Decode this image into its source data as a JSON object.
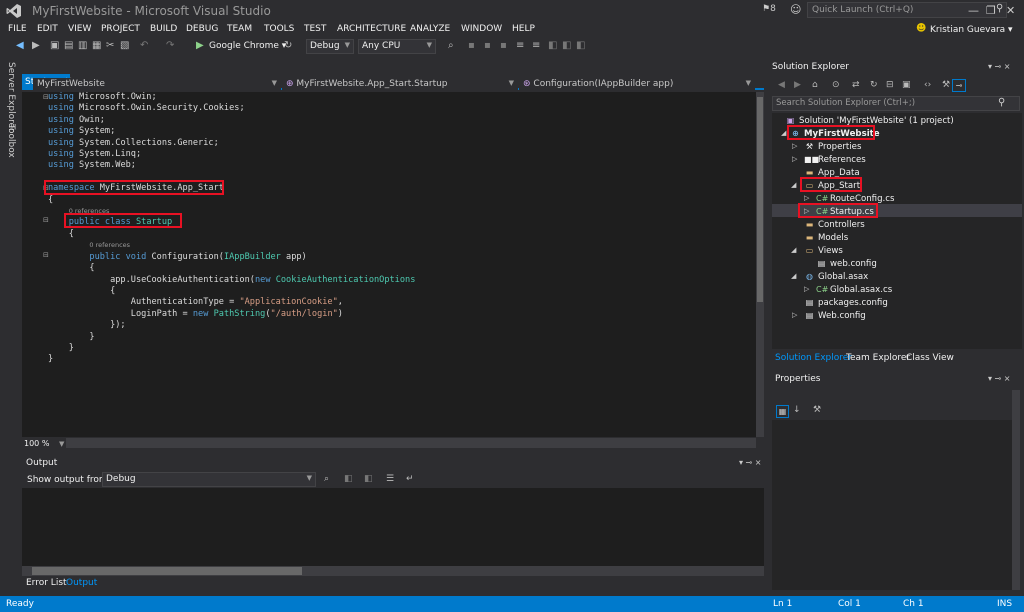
{
  "window": {
    "title": "MyFirstWebsite - Microsoft Visual Studio",
    "notification_count": "8",
    "quick_launch_placeholder": "Quick Launch (Ctrl+Q)",
    "user": "Kristian Guevara"
  },
  "menu": [
    "FILE",
    "EDIT",
    "VIEW",
    "PROJECT",
    "BUILD",
    "DEBUG",
    "TEAM",
    "TOOLS",
    "TEST",
    "ARCHITECTURE",
    "ANALYZE",
    "WINDOW",
    "HELP"
  ],
  "toolbar": {
    "browser_label": "Google Chrome",
    "config": "Debug",
    "platform": "Any CPU"
  },
  "side_tabs": {
    "server_explorer": "Server Explorer",
    "toolbox": "Toolbox"
  },
  "editor": {
    "tab_label": "Startup.cs",
    "nav_project": "MyFirstWebsite",
    "nav_class": "MyFirstWebsite.App_Start.Startup",
    "nav_member": "Configuration(IAppBuilder app)",
    "zoom": "100 %",
    "references": "0 references"
  },
  "output": {
    "title": "Output",
    "show_from_label": "Show output from:",
    "source": "Debug"
  },
  "bottom_tabs": {
    "error_list": "Error List",
    "output": "Output"
  },
  "solution_explorer": {
    "title": "Solution Explorer",
    "search_placeholder": "Search Solution Explorer (Ctrl+;)",
    "tree": {
      "solution": "Solution 'MyFirstWebsite' (1 project)",
      "project": "MyFirstWebsite",
      "properties": "Properties",
      "references": "References",
      "app_data": "App_Data",
      "app_start": "App_Start",
      "route_config": "RouteConfig.cs",
      "startup": "Startup.cs",
      "controllers": "Controllers",
      "models": "Models",
      "views": "Views",
      "views_web_config": "web.config",
      "global_asax": "Global.asax",
      "global_asax_cs": "Global.asax.cs",
      "packages_config": "packages.config",
      "web_config": "Web.config"
    },
    "tabs": {
      "solution_explorer": "Solution Explorer",
      "team_explorer": "Team Explorer",
      "class_view": "Class View"
    }
  },
  "properties_panel": {
    "title": "Properties"
  },
  "status": {
    "ready": "Ready",
    "ln": "Ln 1",
    "col": "Col 1",
    "ch": "Ch 1",
    "ins": "INS"
  },
  "colors": {
    "accent": "#007acc",
    "highlight": "#e81123",
    "background": "#2d2d30",
    "editor_bg": "#1e1e1e"
  }
}
